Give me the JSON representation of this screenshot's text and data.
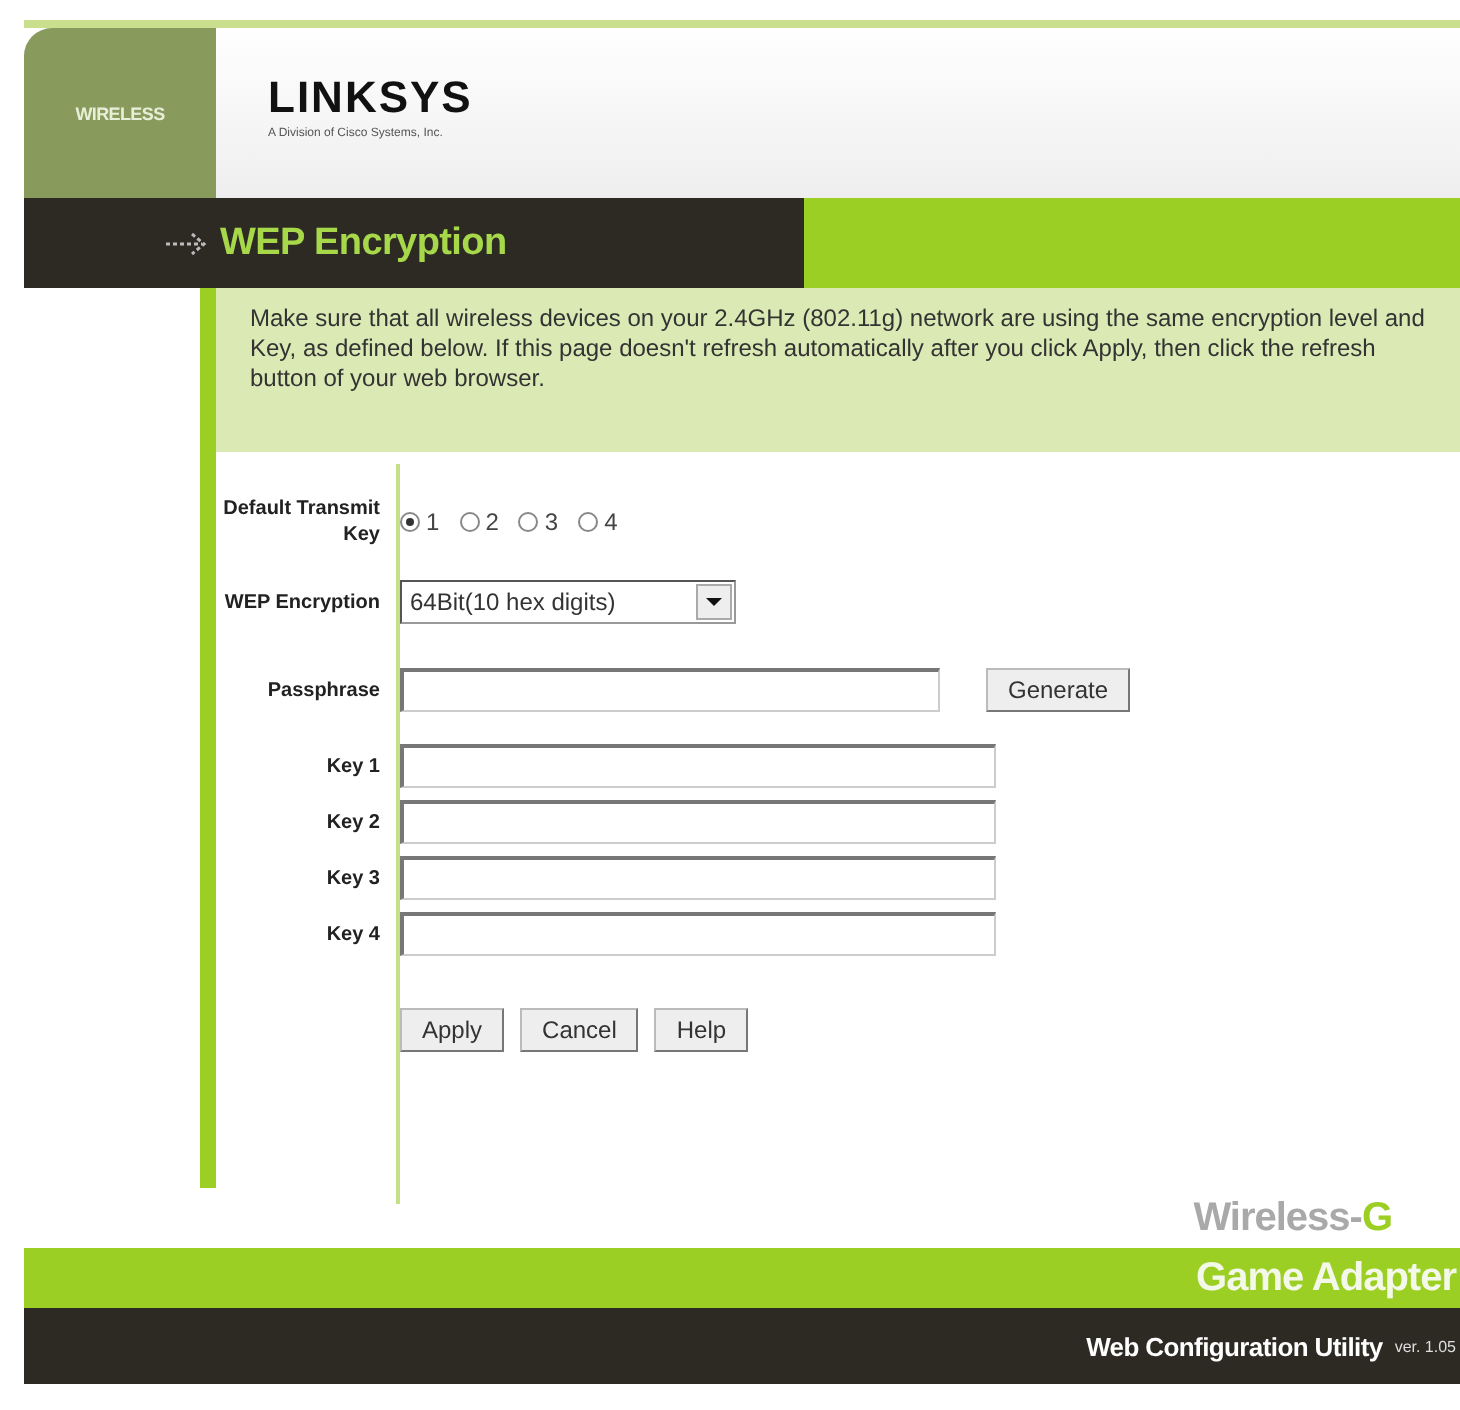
{
  "header": {
    "side_label": "WIRELESS",
    "logo": "LINKSYS",
    "logo_subtitle": "A Division of Cisco Systems, Inc."
  },
  "page_title": "WEP Encryption",
  "intro": "Make sure that all wireless devices on your 2.4GHz (802.11g) network are using the same encryption level and Key, as defined below. If this page doesn't refresh automatically after you click Apply, then click the refresh button of your web browser.",
  "form": {
    "transmit_key": {
      "label": "Default Transmit Key",
      "options": [
        {
          "label": "1",
          "selected": true
        },
        {
          "label": "2",
          "selected": false
        },
        {
          "label": "3",
          "selected": false
        },
        {
          "label": "4",
          "selected": false
        }
      ]
    },
    "wep_encryption": {
      "label": "WEP Encryption",
      "value": "64Bit(10 hex digits)"
    },
    "passphrase": {
      "label": "Passphrase",
      "button": "Generate"
    },
    "keys": [
      {
        "label": "Key 1"
      },
      {
        "label": "Key 2"
      },
      {
        "label": "Key 3"
      },
      {
        "label": "Key 4"
      }
    ],
    "buttons": [
      "Apply",
      "Cancel",
      "Help"
    ]
  },
  "footer": {
    "product": "Wireless-",
    "product_mark": "G",
    "product_type": "Game Adapter",
    "utility": "Web Configuration Utility",
    "version": "ver. 1.05"
  }
}
